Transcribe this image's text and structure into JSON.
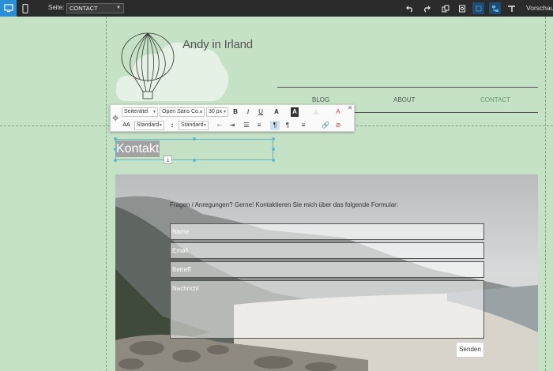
{
  "topbar": {
    "page_label": "Seite:",
    "page_value": "CONTACT",
    "preview_label": "Vorschau"
  },
  "site": {
    "title": "Andy in Irland"
  },
  "nav": {
    "items": [
      "BLOG",
      "ABOUT",
      "CONTACT"
    ],
    "active": "CONTACT"
  },
  "format_toolbar": {
    "style": "Seitentitel",
    "font": "Open Sans Co...",
    "size": "30 px",
    "spacing": "Standard",
    "line_height": "Standard",
    "bold": "B",
    "italic": "I",
    "underline": "U"
  },
  "heading": {
    "text": "Kontakt"
  },
  "contact": {
    "intro": "Fragen / Anregungen? Gerne! Kontaktieren Sie mich über das folgende Formular:",
    "name_placeholder": "Name",
    "email_placeholder": "Email",
    "subject_placeholder": "Betreff",
    "message_placeholder": "Nachricht",
    "send_label": "Senden"
  },
  "colors": {
    "canvas": "#c6e2c6",
    "topbar": "#2b2b2b",
    "accent": "#2a8fd6",
    "nav_active": "#5c9a6a",
    "selection": "#63b8c7"
  }
}
